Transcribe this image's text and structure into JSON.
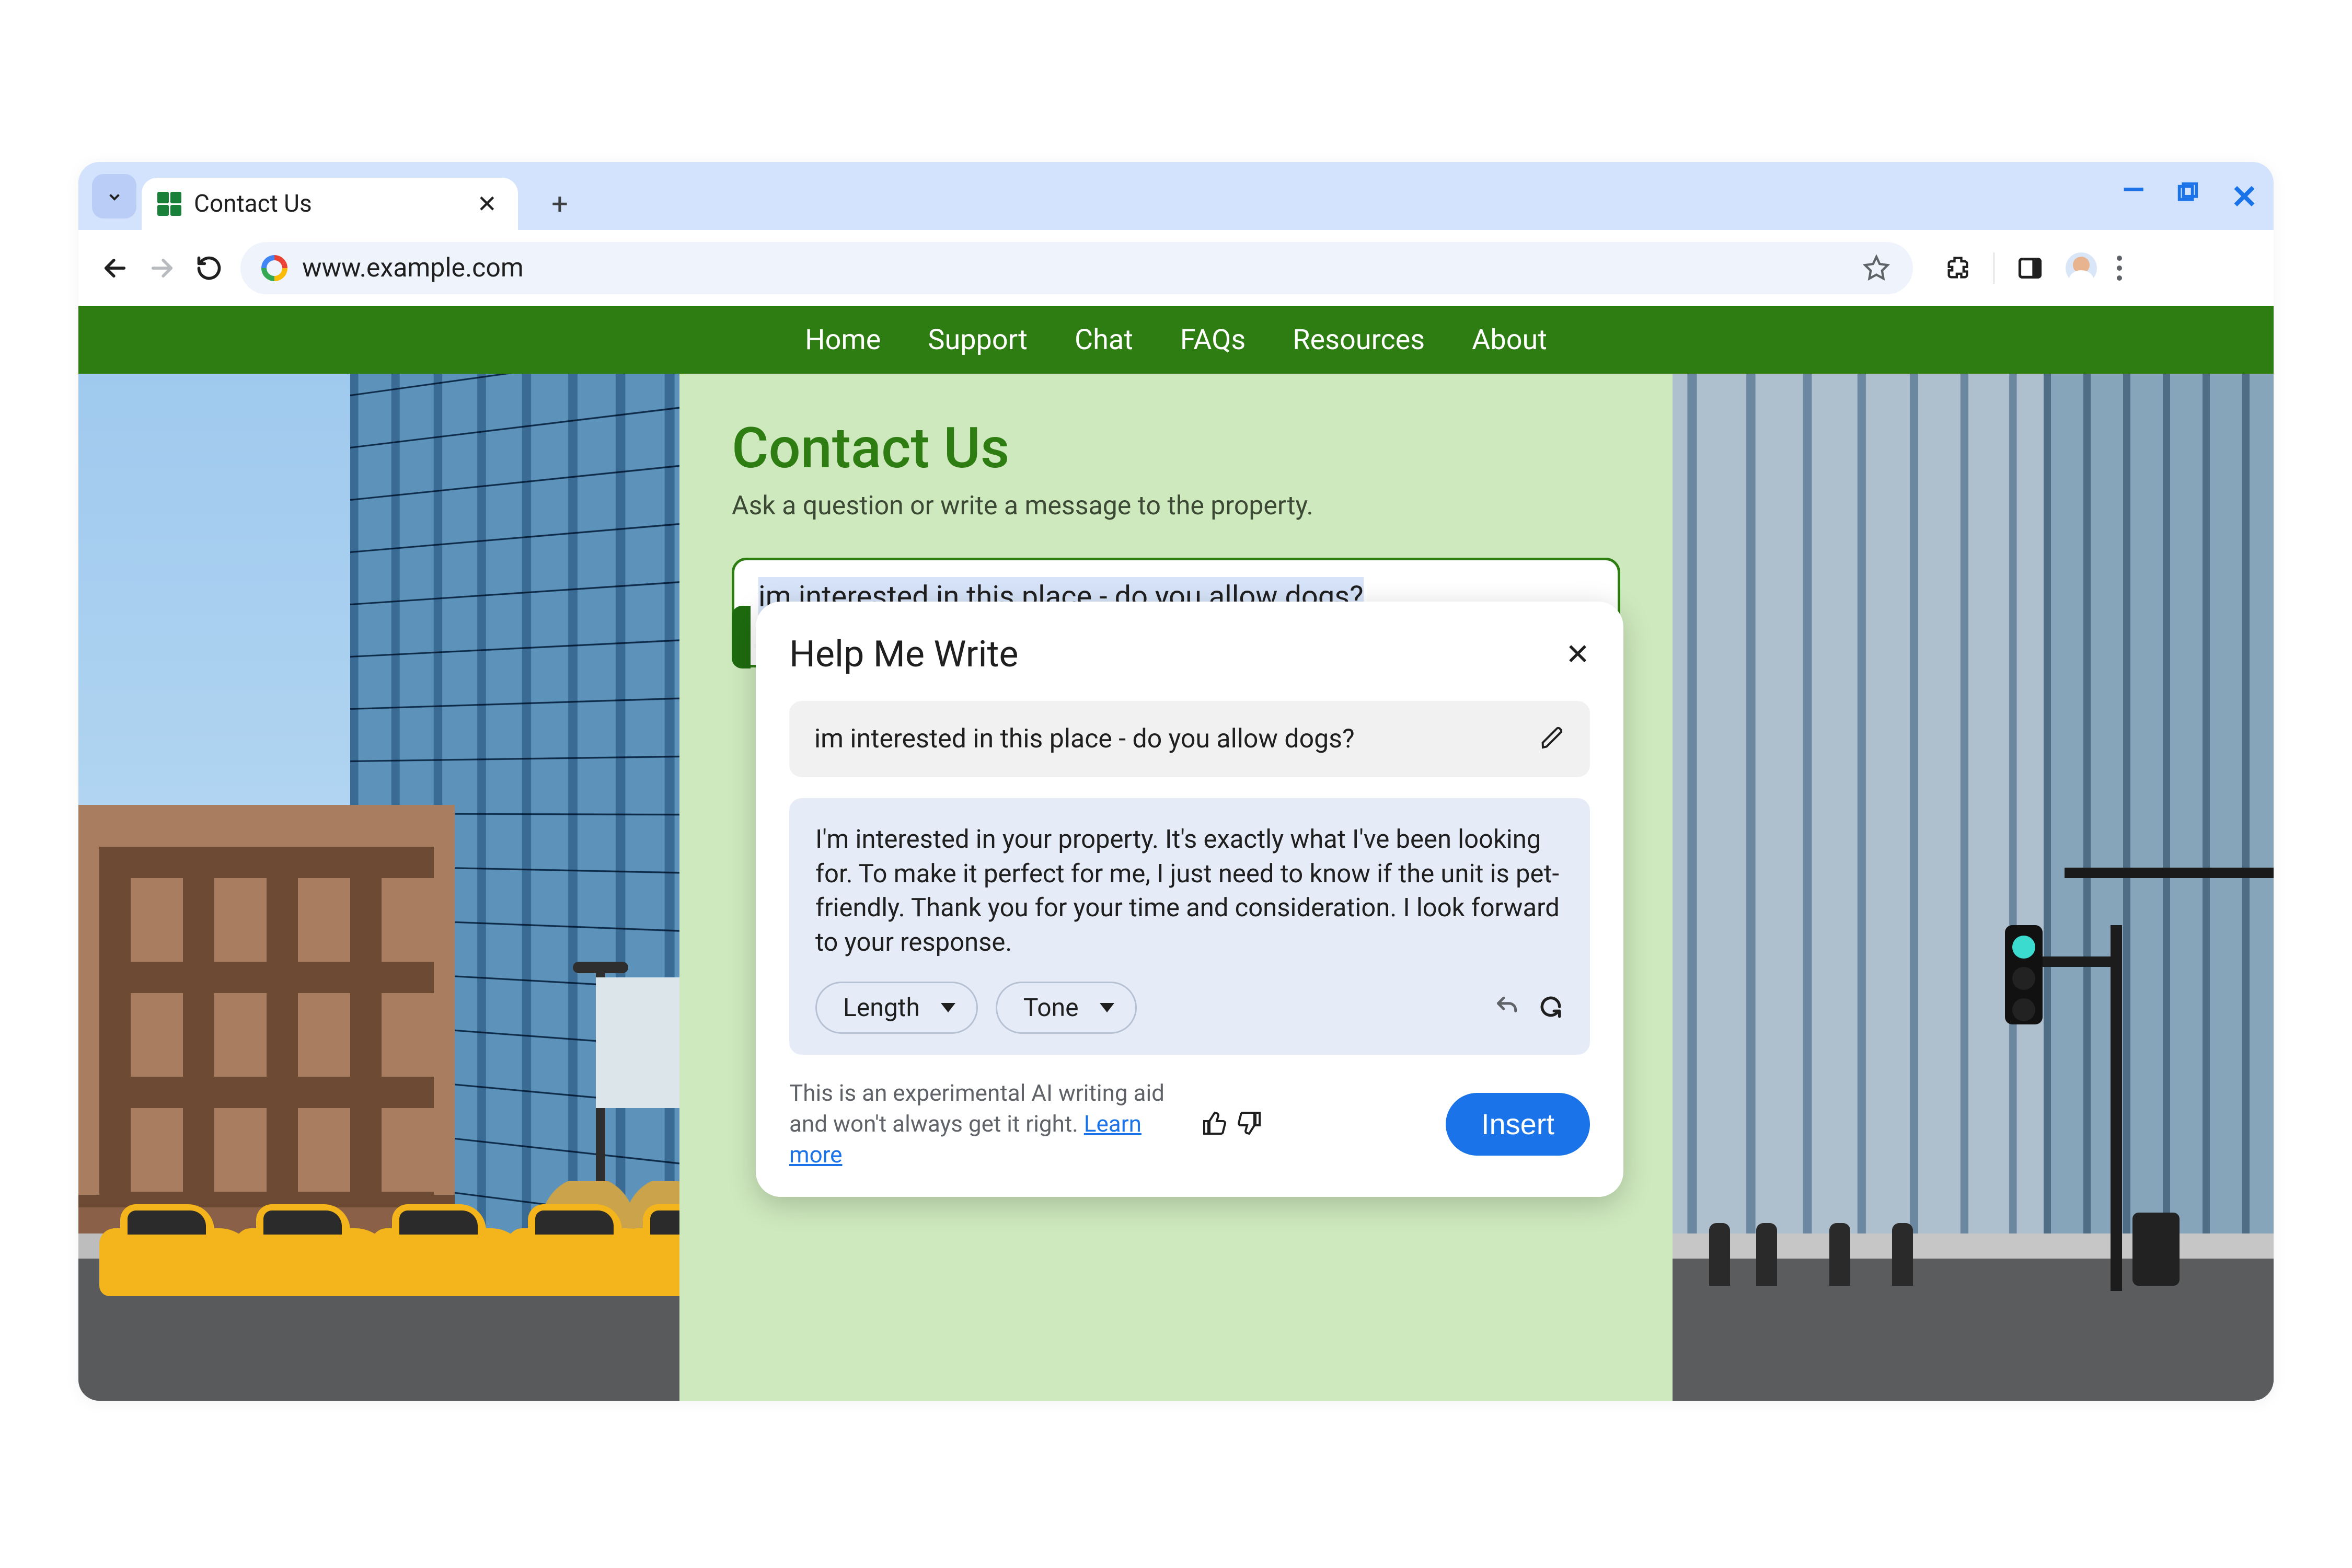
{
  "browser": {
    "tab_title": "Contact Us",
    "url": "www.example.com"
  },
  "nav": {
    "items": [
      "Home",
      "Support",
      "Chat",
      "FAQs",
      "Resources",
      "About"
    ]
  },
  "page": {
    "heading": "Contact Us",
    "subheading": "Ask a question or write a message to the property.",
    "textarea_value": "im interested in this place - do you allow dogs?"
  },
  "hmw": {
    "title": "Help Me Write",
    "prompt": "im interested in this place - do you allow dogs?",
    "suggestion": "I'm interested in your property. It's exactly what I've been looking for. To make it perfect for me, I just need to know if the unit is pet-friendly. Thank you for your time and consideration. I look forward to your response.",
    "length_label": "Length",
    "tone_label": "Tone",
    "disclaimer_1": "This is an experimental AI writing aid and won't always get it right. ",
    "learn_more": "Learn more",
    "insert_label": "Insert"
  }
}
